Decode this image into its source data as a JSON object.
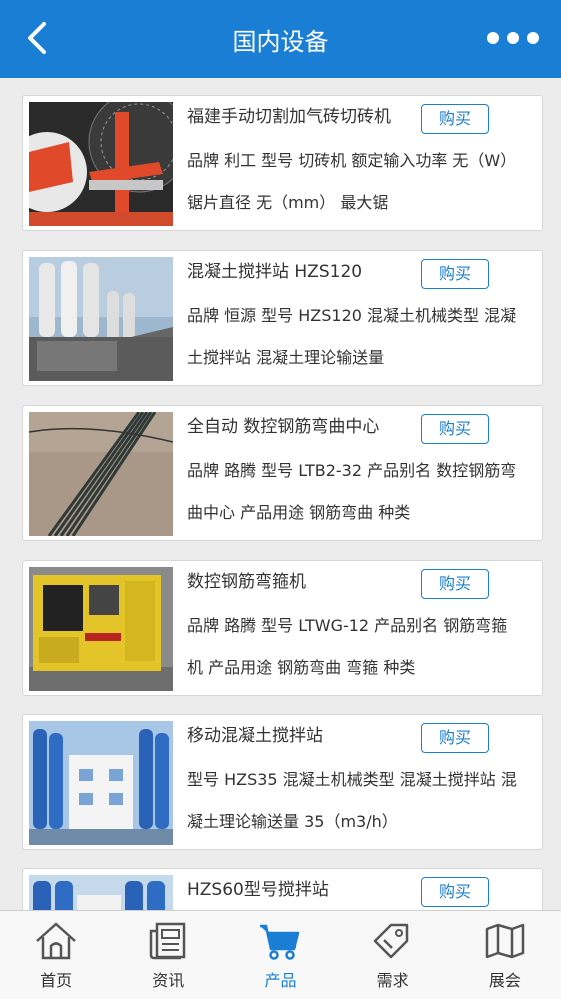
{
  "header": {
    "title": "国内设备",
    "back_icon": "chevron-left-icon",
    "more_icon": "more-dots-icon"
  },
  "products": [
    {
      "title": "福建手动切割加气砖切砖机",
      "buy_label": "购买",
      "desc": "品牌 利工 型号 切砖机 额定输入功率 无（W） 锯片直径 无（mm） 最大锯"
    },
    {
      "title": "混凝土搅拌站 HZS120",
      "buy_label": "购买",
      "desc": "品牌 恒源 型号 HZS120 混凝土机械类型 混凝土搅拌站 混凝土理论输送量"
    },
    {
      "title": "全自动 数控钢筋弯曲中心",
      "buy_label": "购买",
      "desc": "品牌 路腾 型号 LTB2-32 产品别名 数控钢筋弯曲中心 产品用途 钢筋弯曲 种类"
    },
    {
      "title": "数控钢筋弯箍机",
      "buy_label": "购买",
      "desc": "品牌 路腾 型号 LTWG-12 产品别名 钢筋弯箍机 产品用途 钢筋弯曲 弯箍 种类"
    },
    {
      "title": "移动混凝土搅拌站",
      "buy_label": "购买",
      "desc": "型号 HZS35 混凝土机械类型 混凝土搅拌站 混凝土理论输送量 35（m3/h）"
    },
    {
      "title": "HZS60型号搅拌站",
      "buy_label": "购买",
      "desc": ""
    }
  ],
  "tabbar": {
    "active": "产品",
    "items": [
      {
        "label": "首页",
        "icon": "home-icon"
      },
      {
        "label": "资讯",
        "icon": "news-icon"
      },
      {
        "label": "产品",
        "icon": "cart-icon"
      },
      {
        "label": "需求",
        "icon": "tag-icon"
      },
      {
        "label": "展会",
        "icon": "map-icon"
      }
    ]
  },
  "colors": {
    "accent": "#1a7fd4",
    "background": "#ececec"
  }
}
